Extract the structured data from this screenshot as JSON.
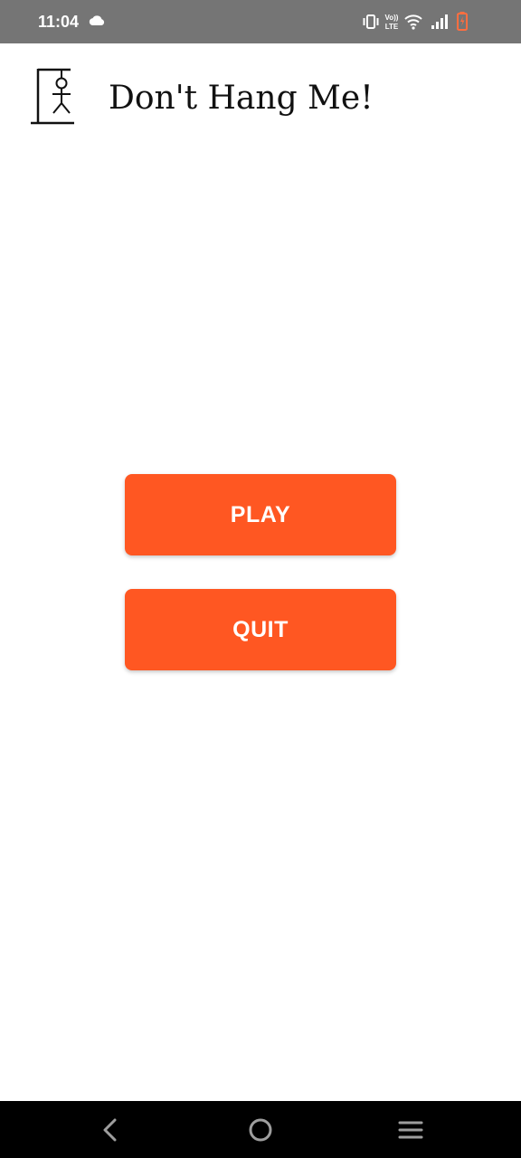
{
  "status_bar": {
    "time": "11:04",
    "icons": [
      "cloud-icon",
      "vibrate-icon",
      "volte-icon",
      "wifi-icon",
      "signal-icon",
      "battery-charging-icon"
    ],
    "volte_label_top": "Vo))",
    "volte_label_bottom": "LTE",
    "battery_color": "#ff6e40"
  },
  "header": {
    "title": "Don't Hang Me!",
    "logo_icon": "hangman-icon"
  },
  "menu": {
    "play_label": "PLAY",
    "quit_label": "QUIT",
    "button_color": "#ff5722"
  },
  "nav_bar": {
    "icons": [
      "back-icon",
      "home-icon",
      "recents-menu-icon"
    ]
  }
}
